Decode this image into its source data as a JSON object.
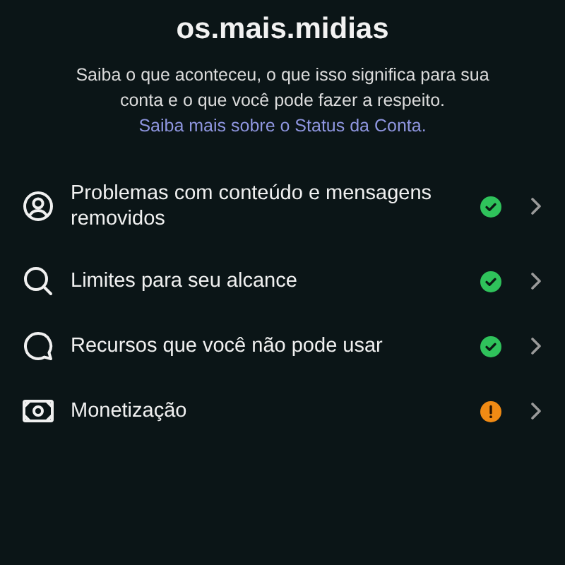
{
  "title": "os.mais.midias",
  "description": "Saiba o que aconteceu, o que isso significa para sua conta e o que você pode fazer a respeito.",
  "link": "Saiba mais sobre o Status da Conta.",
  "items": [
    {
      "label": "Problemas com conteúdo e mensagens removidos",
      "kind": "ok"
    },
    {
      "label": "Limites para seu alcance",
      "kind": "ok"
    },
    {
      "label": "Recursos que você não pode usar",
      "kind": "ok"
    },
    {
      "label": "Monetização",
      "kind": "warning"
    }
  ]
}
